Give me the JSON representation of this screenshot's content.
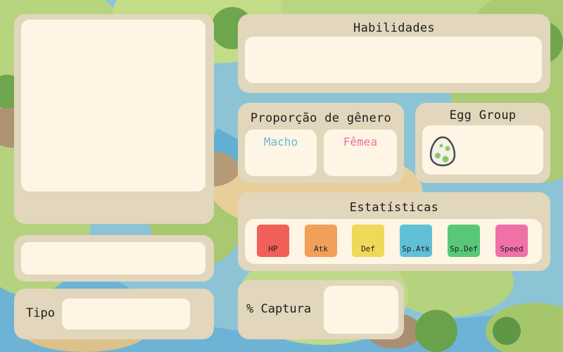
{
  "portrait": {},
  "name": {
    "value": ""
  },
  "type": {
    "label": "Tipo",
    "value": ""
  },
  "abilities": {
    "title": "Habilidades",
    "value": ""
  },
  "gender": {
    "title": "Proporção de gênero",
    "male_label": "Macho",
    "female_label": "Fêmea"
  },
  "egg_group": {
    "title": "Egg Group",
    "icon": "egg-icon"
  },
  "stats": {
    "title": "Estatísticas",
    "items": [
      {
        "label": "HP",
        "color": "#f06058"
      },
      {
        "label": "Atk",
        "color": "#f0a058"
      },
      {
        "label": "Def",
        "color": "#f0d858"
      },
      {
        "label": "Sp.Atk",
        "color": "#60c0d8"
      },
      {
        "label": "Sp.Def",
        "color": "#58c878"
      },
      {
        "label": "Speed",
        "color": "#f070a8"
      }
    ]
  },
  "capture": {
    "label": "% Captura",
    "value": ""
  },
  "colors": {
    "panel": "#e2d6bc",
    "inner": "#fef5e4",
    "male": "#6ab8d4",
    "female": "#ee6fa0"
  }
}
